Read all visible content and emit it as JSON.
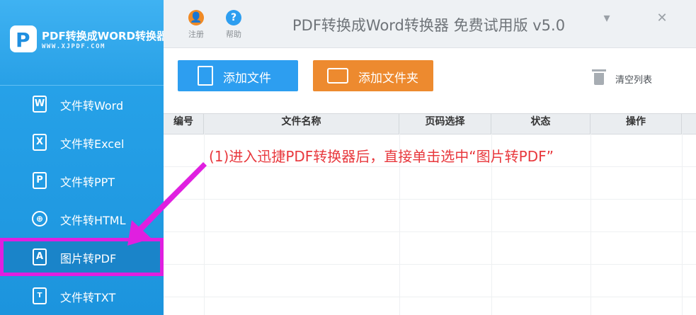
{
  "brand": {
    "logo_letter": "P",
    "title": "PDF转换成WORD转换器",
    "url": "WWW.XJPDF.COM"
  },
  "sidebar": {
    "items": [
      {
        "label": "文件转Word",
        "icon": "word-file-icon",
        "glyph": "W",
        "active": false
      },
      {
        "label": "文件转Excel",
        "icon": "excel-file-icon",
        "glyph": "X",
        "active": false
      },
      {
        "label": "文件转PPT",
        "icon": "ppt-file-icon",
        "glyph": "P",
        "active": false
      },
      {
        "label": "文件转HTML",
        "icon": "globe-icon",
        "glyph": "⊕",
        "active": false
      },
      {
        "label": "图片转PDF",
        "icon": "pdf-file-icon",
        "glyph": "A",
        "active": true
      },
      {
        "label": "文件转TXT",
        "icon": "txt-file-icon",
        "glyph": "T",
        "active": false
      }
    ]
  },
  "topbar": {
    "register_label": "注册",
    "help_label": "帮助",
    "register_glyph": "👤",
    "help_glyph": "?",
    "app_title": "PDF转换成Word转换器 免费试用版 v5.0",
    "minimize_glyph": "▾",
    "close_glyph": "✕"
  },
  "toolbar": {
    "add_file_label": "添加文件",
    "add_folder_label": "添加文件夹",
    "clear_list_label": "清空列表"
  },
  "table": {
    "columns": [
      "编号",
      "文件名称",
      "页码选择",
      "状态",
      "操作"
    ],
    "rows": []
  },
  "annotation": {
    "text": "(1)进入迅捷PDF转换器后，直接单击选中“图片转PDF”"
  },
  "colors": {
    "sidebar": "#1c94dd",
    "add_file": "#2d9ef0",
    "add_folder": "#ed8a2f",
    "highlight": "#e01fe0",
    "annotation": "#e8383d",
    "register_icon": "#f08a24",
    "help_icon": "#2d9ef0"
  }
}
